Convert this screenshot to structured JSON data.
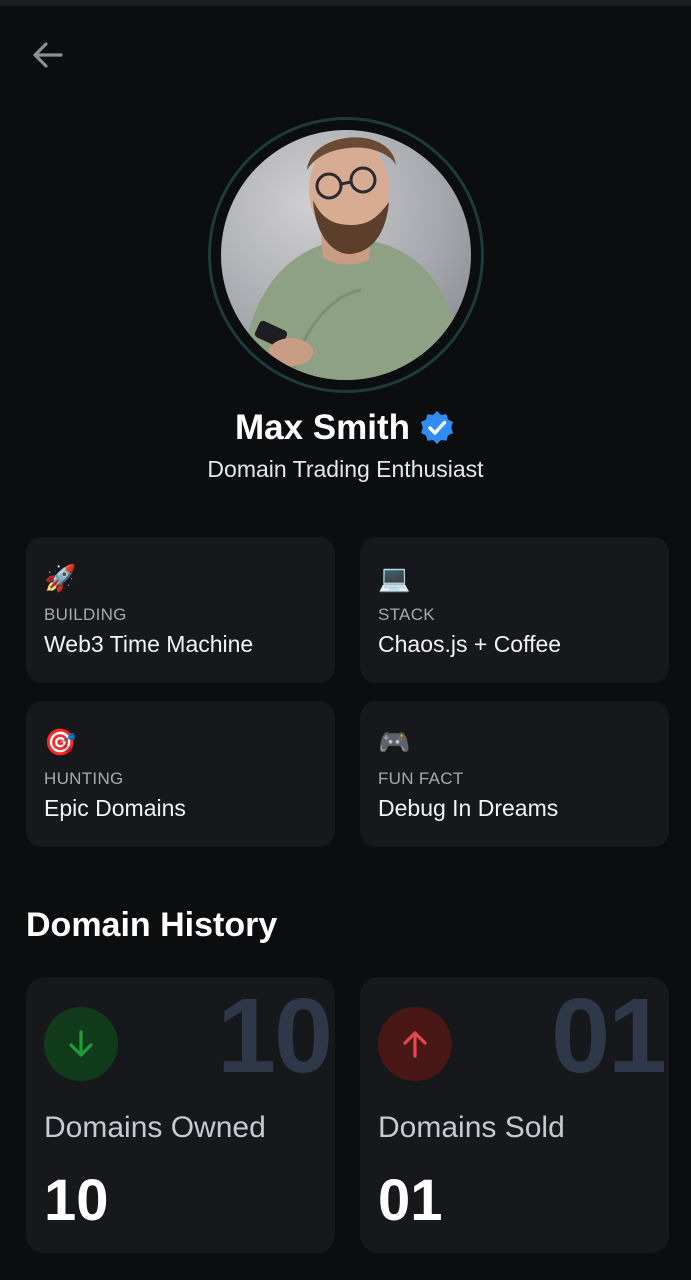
{
  "profile": {
    "name": "Max Smith",
    "title": "Domain Trading Enthusiast",
    "verified": true
  },
  "cards": [
    {
      "icon": "rocket-icon",
      "emoji": "🚀",
      "label": "BUILDING",
      "value": "Web3 Time Machine"
    },
    {
      "icon": "laptop-icon",
      "emoji": "💻",
      "label": "STACK",
      "value": "Chaos.js + Coffee"
    },
    {
      "icon": "target-icon",
      "emoji": "🎯",
      "label": "HUNTING",
      "value": "Epic Domains"
    },
    {
      "icon": "gamepad-icon",
      "emoji": "🎮",
      "label": "FUN FACT",
      "value": "Debug In Dreams"
    }
  ],
  "history": {
    "title": "Domain History",
    "owned": {
      "label": "Domains Owned",
      "value": "10",
      "background_value": "10",
      "accent": "#1f9d3a",
      "circle_bg": "#123b1c"
    },
    "sold": {
      "label": "Domains Sold",
      "value": "01",
      "background_value": "01",
      "accent": "#e5484d",
      "circle_bg": "#4a1717"
    }
  },
  "colors": {
    "background": "#0c0d0f",
    "card": "#17181b",
    "verified_badge": "#2f8df5"
  }
}
